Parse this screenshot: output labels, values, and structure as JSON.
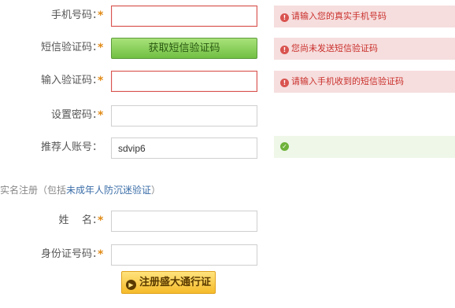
{
  "form": {
    "phone": {
      "label": "手机号码：",
      "required": "*",
      "value": "",
      "error": "请输入您的真实手机号码"
    },
    "sms_code": {
      "label": "短信验证码：",
      "required": "*",
      "button": "获取短信验证码",
      "error": "您尚未发送短信验证码"
    },
    "verify_code": {
      "label": "输入验证码：",
      "required": "*",
      "value": "",
      "error": "请输入手机收到的短信验证码"
    },
    "password": {
      "label": "设置密码：",
      "required": "*",
      "value": ""
    },
    "referrer": {
      "label": "推荐人账号：",
      "value": "sdvip6",
      "status_icon": "check-icon"
    }
  },
  "real_name": {
    "prefix": "实名注册（包括",
    "link": "未成年人防沉迷验证",
    "suffix": "）",
    "name": {
      "label": "姓    名：",
      "required": "*",
      "value": ""
    },
    "id_number": {
      "label": "身份证号码：",
      "required": "*",
      "value": ""
    }
  },
  "submit": {
    "label": "注册盛大通行证",
    "icon": "arrow-right-icon"
  },
  "colors": {
    "error_bg": "#f6dede",
    "error_text": "#c9302c",
    "ok_bg": "#eef7e8",
    "accent": "#e08a16"
  }
}
